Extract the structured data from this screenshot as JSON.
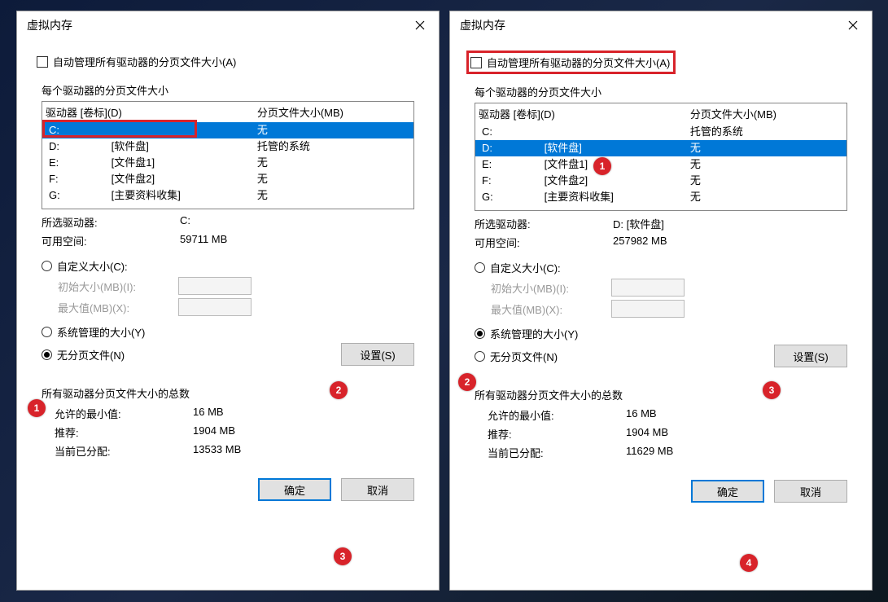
{
  "title": "虚拟内存",
  "auto_manage_label": "自动管理所有驱动器的分页文件大小(A)",
  "per_drive_label": "每个驱动器的分页文件大小",
  "col_drive": "驱动器 [卷标](D)",
  "col_page": "分页文件大小(MB)",
  "selected_drive_label": "所选驱动器:",
  "free_space_label": "可用空间:",
  "custom_size_label": "自定义大小(C):",
  "initial_size_label": "初始大小(MB)(I):",
  "max_size_label": "最大值(MB)(X):",
  "system_managed_label": "系统管理的大小(Y)",
  "no_paging_label": "无分页文件(N)",
  "set_btn": "设置(S)",
  "totals_title": "所有驱动器分页文件大小的总数",
  "min_allowed_label": "允许的最小值:",
  "recommended_label": "推荐:",
  "current_label": "当前已分配:",
  "ok_btn": "确定",
  "cancel_btn": "取消",
  "left": {
    "drives": [
      {
        "d": "C:",
        "l": "",
        "p": "无"
      },
      {
        "d": "D:",
        "l": "[软件盘]",
        "p": "托管的系统"
      },
      {
        "d": "E:",
        "l": "[文件盘1]",
        "p": "无"
      },
      {
        "d": "F:",
        "l": "[文件盘2]",
        "p": "无"
      },
      {
        "d": "G:",
        "l": "[主要资料收集]",
        "p": "无"
      }
    ],
    "selected_drive": "C:",
    "free_space": "59711 MB",
    "min_allowed": "16 MB",
    "recommended": "1904 MB",
    "current": "13533 MB"
  },
  "right": {
    "drives": [
      {
        "d": "C:",
        "l": "",
        "p": "托管的系统"
      },
      {
        "d": "D:",
        "l": "[软件盘]",
        "p": "无"
      },
      {
        "d": "E:",
        "l": "[文件盘1]",
        "p": "无"
      },
      {
        "d": "F:",
        "l": "[文件盘2]",
        "p": "无"
      },
      {
        "d": "G:",
        "l": "[主要资料收集]",
        "p": "无"
      }
    ],
    "selected_drive": "D:  [软件盘]",
    "free_space": "257982 MB",
    "min_allowed": "16 MB",
    "recommended": "1904 MB",
    "current": "11629 MB"
  }
}
